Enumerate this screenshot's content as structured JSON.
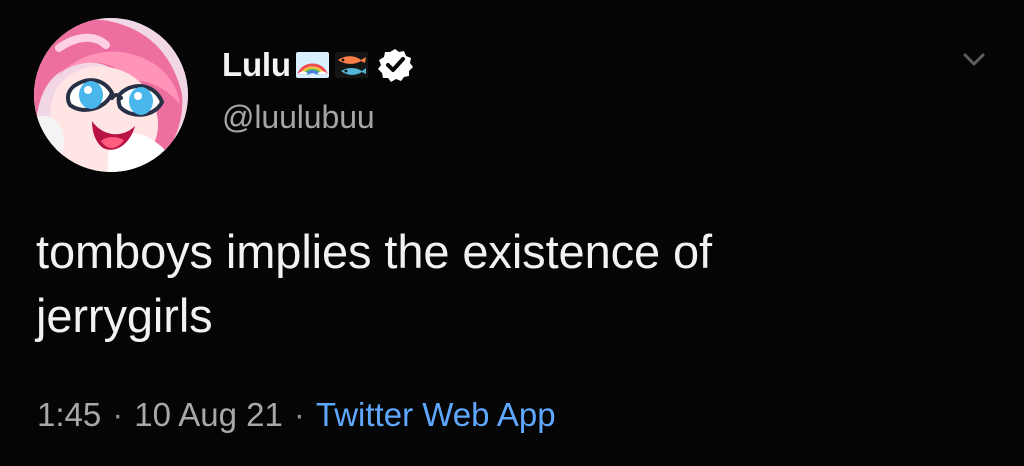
{
  "author": {
    "display_name": "Lulu",
    "handle": "@luulubuu",
    "avatar_icon": "avatar-anime-girl-icon",
    "name_emojis": [
      "rainbow-emoji-icon",
      "fish-emoji-icon"
    ],
    "verified_icon": "verified-badge-icon"
  },
  "tweet": {
    "text": "tomboys implies the existence of\njerrygirls",
    "time": "1:45",
    "date": "10 Aug 21",
    "separator": "·",
    "source": "Twitter Web App",
    "menu_icon": "chevron-down-icon"
  },
  "colors": {
    "background": "#050505",
    "text": "#f2f2f2",
    "secondary_text": "#a8a8a8",
    "link": "#5fa8ff",
    "verified_badge": "#ffffff"
  }
}
